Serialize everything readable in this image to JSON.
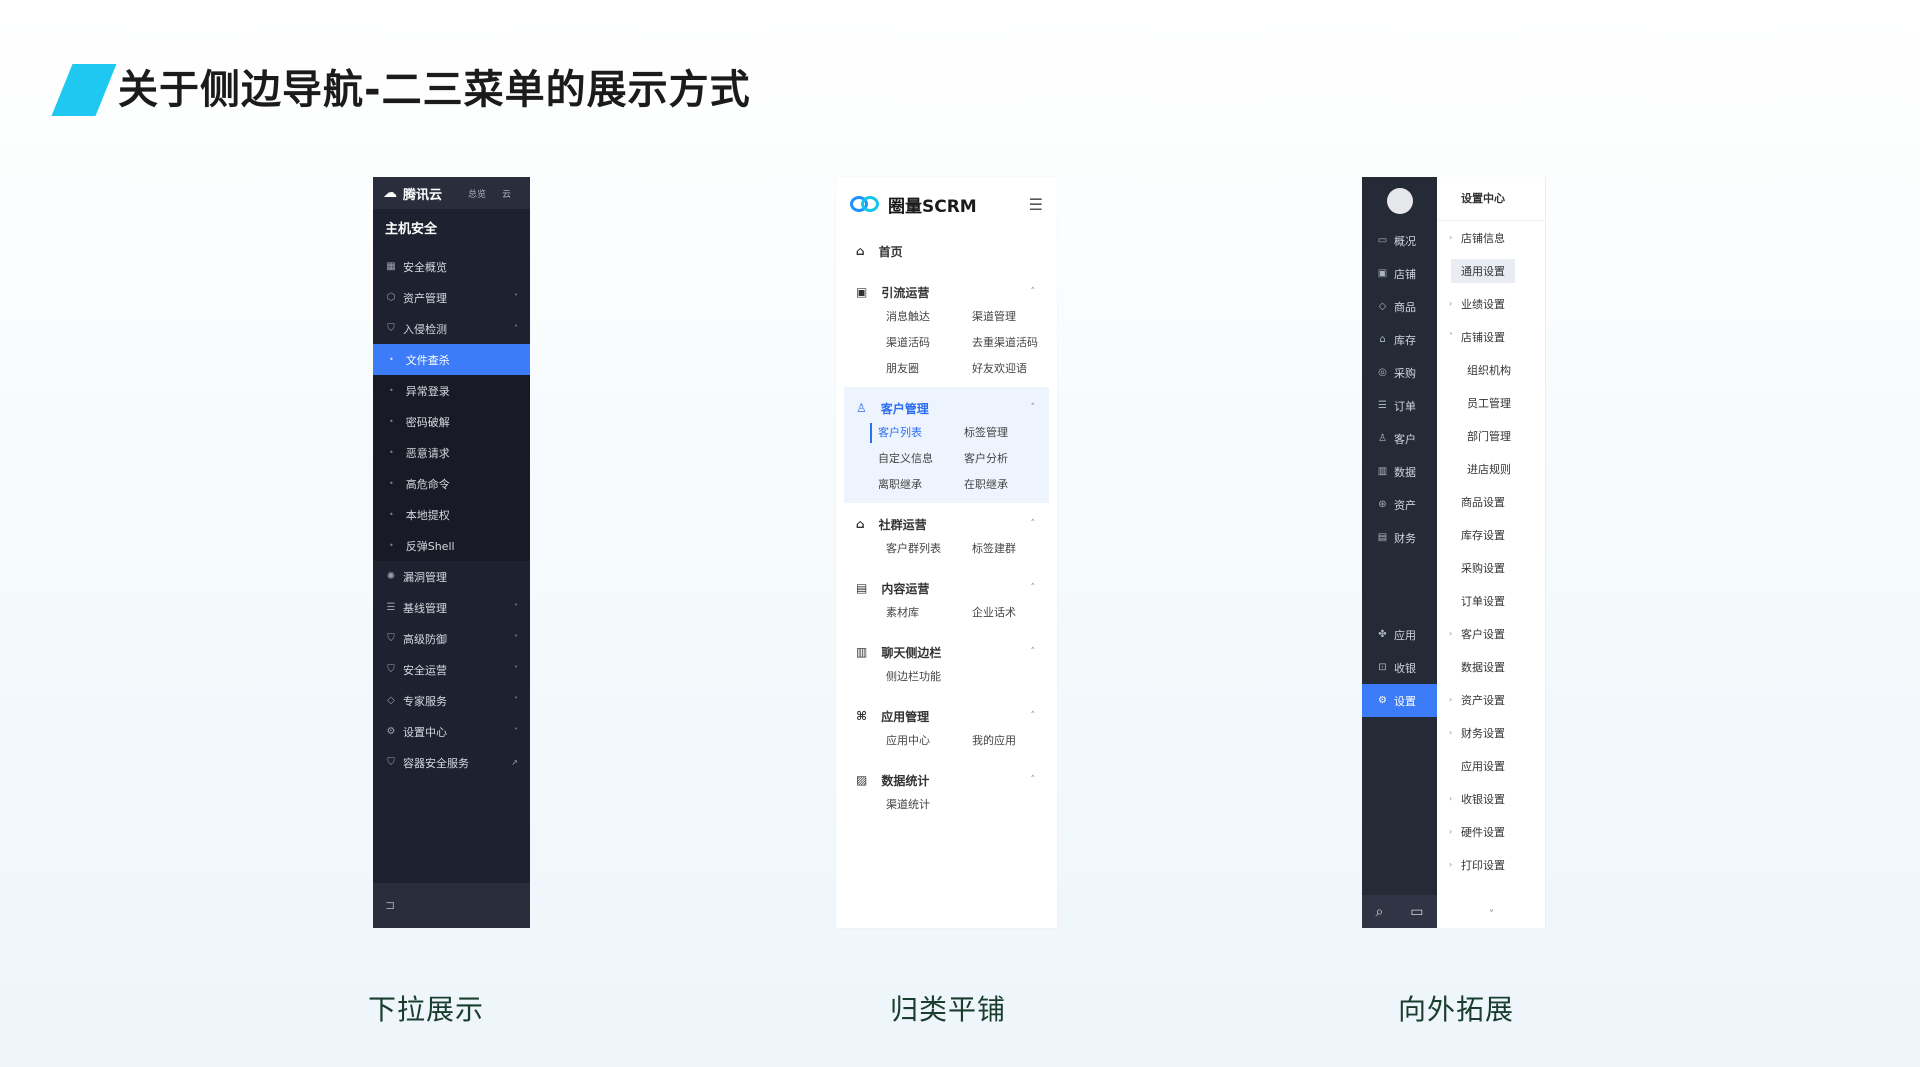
{
  "slide": {
    "title": "关于侧边导航-二三菜单的展示方式",
    "captions": [
      "下拉展示",
      "归类平铺",
      "向外拓展"
    ]
  },
  "panel1": {
    "brand": "腾讯云",
    "tabs": [
      "总览",
      "云"
    ],
    "section_title": "主机安全",
    "items_top": [
      {
        "label": "安全概览",
        "icon": "grid-icon",
        "arrow": ""
      },
      {
        "label": "资产管理",
        "icon": "cube-icon",
        "arrow": "˅"
      },
      {
        "label": "入侵检测",
        "icon": "shield-icon",
        "arrow": "˄"
      }
    ],
    "sub_items": [
      "文件查杀",
      "异常登录",
      "密码破解",
      "恶意请求",
      "高危命令",
      "本地提权",
      "反弹Shell"
    ],
    "active_sub": "文件查杀",
    "items_bottom": [
      {
        "label": "漏洞管理",
        "icon": "bug-icon",
        "arrow": ""
      },
      {
        "label": "基线管理",
        "icon": "list-icon",
        "arrow": "˅"
      },
      {
        "label": "高级防御",
        "icon": "shield-icon",
        "arrow": "˅"
      },
      {
        "label": "安全运营",
        "icon": "shield-icon",
        "arrow": "˅"
      },
      {
        "label": "专家服务",
        "icon": "diamond-icon",
        "arrow": "˅"
      },
      {
        "label": "设置中心",
        "icon": "gear-icon",
        "arrow": "˅"
      },
      {
        "label": "容器安全服务",
        "icon": "shield-icon",
        "arrow": "↗"
      }
    ],
    "bottom_icon": "collapse-icon"
  },
  "panel2": {
    "brand": "圈量SCRM",
    "home": "首页",
    "groups": [
      {
        "title": "引流运营",
        "icon": "monitor-icon",
        "items": [
          "消息触达",
          "渠道管理",
          "渠道活码",
          "去重渠道活码",
          "朋友圈",
          "好友欢迎语"
        ],
        "highlight": false
      },
      {
        "title": "客户管理",
        "icon": "user-icon",
        "items": [
          "客户列表",
          "标签管理",
          "自定义信息",
          "客户分析",
          "离职继承",
          "在职继承"
        ],
        "highlight": true,
        "active": "客户列表"
      },
      {
        "title": "社群运营",
        "icon": "group-icon",
        "items": [
          "客户群列表",
          "标签建群"
        ],
        "highlight": false
      },
      {
        "title": "内容运营",
        "icon": "doc-icon",
        "items": [
          "素材库",
          "企业话术"
        ],
        "highlight": false
      },
      {
        "title": "聊天侧边栏",
        "icon": "sidebar-icon",
        "items": [
          "侧边栏功能"
        ],
        "highlight": false
      },
      {
        "title": "应用管理",
        "icon": "apps-icon",
        "items": [
          "应用中心",
          "我的应用"
        ],
        "highlight": false
      },
      {
        "title": "数据统计",
        "icon": "chart-icon",
        "items": [
          "渠道统计"
        ],
        "highlight": false
      }
    ]
  },
  "panel3": {
    "rail_top": [
      "概况",
      "店铺",
      "商品",
      "库存",
      "采购",
      "订单",
      "客户",
      "数据",
      "资产",
      "财务"
    ],
    "rail_bottom": [
      "应用",
      "收银",
      "设置"
    ],
    "rail_active": "设置",
    "sub_title": "设置中心",
    "sub_items": [
      {
        "label": "店铺信息",
        "arrow": "›",
        "indent": false,
        "selected": false
      },
      {
        "label": "通用设置",
        "arrow": "",
        "indent": false,
        "selected": true
      },
      {
        "label": "业绩设置",
        "arrow": "›",
        "indent": false,
        "selected": false
      },
      {
        "label": "店铺设置",
        "arrow": "˅",
        "indent": false,
        "selected": false
      },
      {
        "label": "组织机构",
        "arrow": "",
        "indent": true,
        "selected": false
      },
      {
        "label": "员工管理",
        "arrow": "",
        "indent": true,
        "selected": false
      },
      {
        "label": "部门管理",
        "arrow": "",
        "indent": true,
        "selected": false
      },
      {
        "label": "进店规则",
        "arrow": "",
        "indent": true,
        "selected": false
      },
      {
        "label": "商品设置",
        "arrow": "",
        "indent": false,
        "selected": false
      },
      {
        "label": "库存设置",
        "arrow": "",
        "indent": false,
        "selected": false
      },
      {
        "label": "采购设置",
        "arrow": "",
        "indent": false,
        "selected": false
      },
      {
        "label": "订单设置",
        "arrow": "",
        "indent": false,
        "selected": false
      },
      {
        "label": "客户设置",
        "arrow": "›",
        "indent": false,
        "selected": false
      },
      {
        "label": "数据设置",
        "arrow": "",
        "indent": false,
        "selected": false
      },
      {
        "label": "资产设置",
        "arrow": "›",
        "indent": false,
        "selected": false
      },
      {
        "label": "财务设置",
        "arrow": "›",
        "indent": false,
        "selected": false
      },
      {
        "label": "应用设置",
        "arrow": "",
        "indent": false,
        "selected": false
      },
      {
        "label": "收银设置",
        "arrow": "›",
        "indent": false,
        "selected": false
      },
      {
        "label": "硬件设置",
        "arrow": "›",
        "indent": false,
        "selected": false
      },
      {
        "label": "打印设置",
        "arrow": "›",
        "indent": false,
        "selected": false
      }
    ]
  }
}
